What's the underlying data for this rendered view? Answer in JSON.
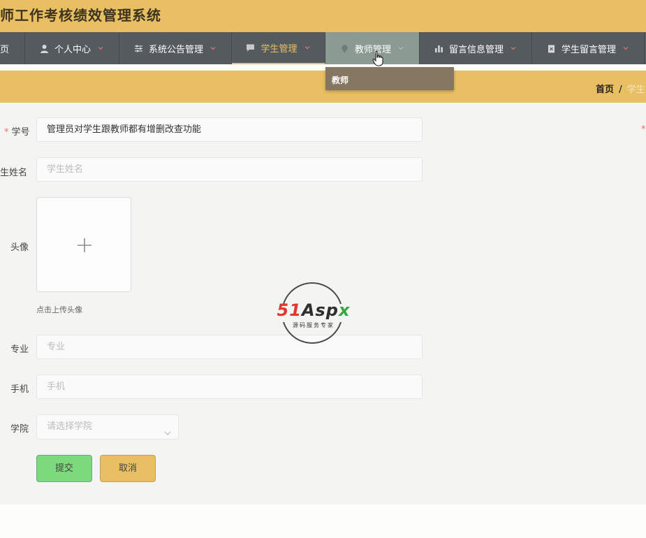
{
  "header": {
    "title": "师工作考核绩效管理系统"
  },
  "nav": {
    "items": [
      {
        "label": "页",
        "icon": "none"
      },
      {
        "label": "个人中心",
        "icon": "user-icon"
      },
      {
        "label": "系统公告管理",
        "icon": "sliders-icon"
      },
      {
        "label": "学生管理",
        "icon": "chat-icon"
      },
      {
        "label": "教师管理",
        "icon": "bulb-icon"
      },
      {
        "label": "留言信息管理",
        "icon": "bar-chart-icon"
      },
      {
        "label": "学生留言管理",
        "icon": "clipboard-icon"
      }
    ],
    "dropdown_item": "教师"
  },
  "breadcrumb": {
    "home": "首页",
    "separator": "/",
    "current": "学生"
  },
  "form": {
    "student_id": {
      "label": "学号",
      "value": "管理员对学生跟教师都有增删改查功能"
    },
    "student_name": {
      "label": "生姓名",
      "placeholder": "学生姓名"
    },
    "avatar": {
      "label": "头像",
      "tip": "点击上传头像"
    },
    "major": {
      "label": "专业",
      "placeholder": "专业"
    },
    "phone": {
      "label": "手机",
      "placeholder": "手机"
    },
    "college": {
      "label": "学院",
      "placeholder": "请选择学院"
    },
    "submit_label": "提交",
    "cancel_label": "取消"
  },
  "watermark": {
    "brand": "51Aspx",
    "tagline": "源码服务专家"
  },
  "colors": {
    "accent": "#e8bf62",
    "nav_bg": "#555a5f",
    "submit": "#7cd97c",
    "required": "#f56c6c"
  }
}
